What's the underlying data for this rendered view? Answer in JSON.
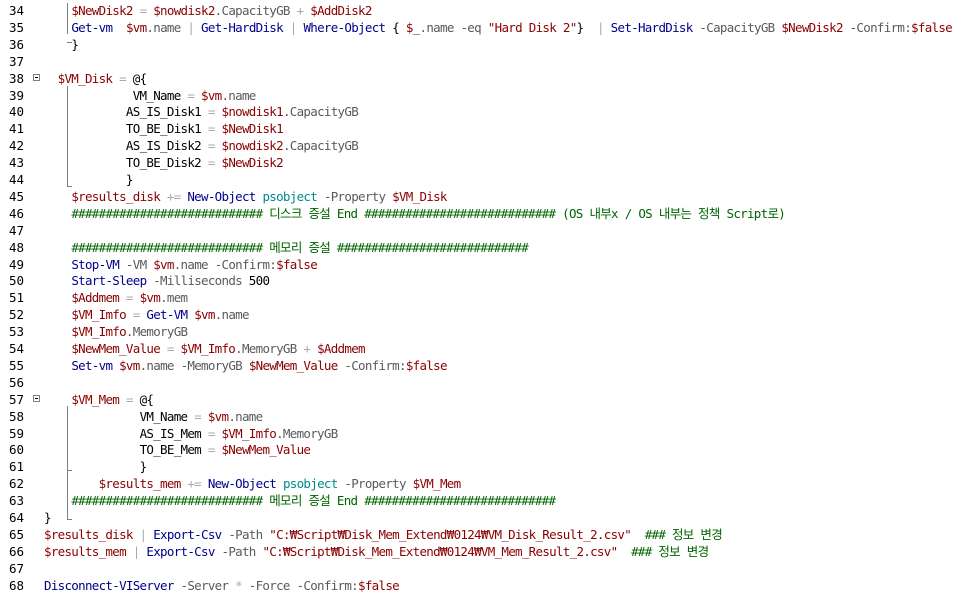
{
  "lines": [
    {
      "n": "34",
      "indent": "    ",
      "tokens": [
        [
          "v",
          "$NewDisk2"
        ],
        [
          "o",
          " = "
        ],
        [
          "v",
          "$nowdisk2"
        ],
        [
          "p",
          ".CapacityGB"
        ],
        [
          "o",
          " + "
        ],
        [
          "v",
          "$AddDisk2"
        ]
      ]
    },
    {
      "n": "35",
      "indent": "    ",
      "tokens": [
        [
          "c",
          "Get-vm"
        ],
        [
          "",
          "  "
        ],
        [
          "v",
          "$vm"
        ],
        [
          "p",
          ".name"
        ],
        [
          "o",
          " | "
        ],
        [
          "c",
          "Get-HardDisk"
        ],
        [
          "o",
          " | "
        ],
        [
          "c",
          "Where-Object"
        ],
        [
          "",
          " { "
        ],
        [
          "v",
          "$_"
        ],
        [
          "p",
          ".name"
        ],
        [
          "",
          " "
        ],
        [
          "p",
          "-eq"
        ],
        [
          "",
          " "
        ],
        [
          "s",
          "\"Hard Disk 2\""
        ],
        [
          "",
          "}  "
        ],
        [
          "o",
          "| "
        ],
        [
          "c",
          "Set-HardDisk"
        ],
        [
          "",
          " "
        ],
        [
          "p",
          "-CapacityGB"
        ],
        [
          "",
          " "
        ],
        [
          "v",
          "$NewDisk2"
        ],
        [
          "",
          " "
        ],
        [
          "p",
          "-Confirm:"
        ],
        [
          "v",
          "$false"
        ]
      ]
    },
    {
      "n": "36",
      "indent": "    ",
      "tokens": [
        [
          "",
          "}"
        ]
      ]
    },
    {
      "n": "37",
      "indent": "",
      "tokens": []
    },
    {
      "n": "38",
      "indent": "  ",
      "tokens": [
        [
          "v",
          "$VM_Disk"
        ],
        [
          "o",
          " = "
        ],
        [
          "",
          "@{"
        ]
      ]
    },
    {
      "n": "39",
      "indent": "             ",
      "tokens": [
        [
          "",
          "VM_Name"
        ],
        [
          "o",
          " = "
        ],
        [
          "v",
          "$vm"
        ],
        [
          "p",
          ".name"
        ]
      ]
    },
    {
      "n": "40",
      "indent": "            ",
      "tokens": [
        [
          "",
          "AS_IS_Disk1"
        ],
        [
          "o",
          " = "
        ],
        [
          "v",
          "$nowdisk1"
        ],
        [
          "p",
          ".CapacityGB"
        ]
      ]
    },
    {
      "n": "41",
      "indent": "            ",
      "tokens": [
        [
          "",
          "TO_BE_Disk1"
        ],
        [
          "o",
          " = "
        ],
        [
          "v",
          "$NewDisk1"
        ]
      ]
    },
    {
      "n": "42",
      "indent": "            ",
      "tokens": [
        [
          "",
          "AS_IS_Disk2"
        ],
        [
          "o",
          " = "
        ],
        [
          "v",
          "$nowdisk2"
        ],
        [
          "p",
          ".CapacityGB"
        ]
      ]
    },
    {
      "n": "43",
      "indent": "            ",
      "tokens": [
        [
          "",
          "TO_BE_Disk2"
        ],
        [
          "o",
          " = "
        ],
        [
          "v",
          "$NewDisk2"
        ]
      ]
    },
    {
      "n": "44",
      "indent": "            ",
      "tokens": [
        [
          "",
          "}"
        ]
      ]
    },
    {
      "n": "45",
      "indent": "    ",
      "tokens": [
        [
          "v",
          "$results_disk"
        ],
        [
          "o",
          " += "
        ],
        [
          "c",
          "New-Object"
        ],
        [
          "",
          " "
        ],
        [
          "t",
          "psobject"
        ],
        [
          "",
          " "
        ],
        [
          "p",
          "-Property"
        ],
        [
          "",
          " "
        ],
        [
          "v",
          "$VM_Disk"
        ]
      ]
    },
    {
      "n": "46",
      "indent": "    ",
      "tokens": [
        [
          "cm",
          "############################ 디스크 증설 End ############################ (OS 내부x / OS 내부는 정책 Script로)"
        ]
      ]
    },
    {
      "n": "47",
      "indent": "",
      "tokens": []
    },
    {
      "n": "48",
      "indent": "    ",
      "tokens": [
        [
          "cm",
          "############################ 메모리 증설 ############################"
        ]
      ]
    },
    {
      "n": "49",
      "indent": "    ",
      "tokens": [
        [
          "c",
          "Stop-VM"
        ],
        [
          "",
          " "
        ],
        [
          "p",
          "-VM"
        ],
        [
          "",
          " "
        ],
        [
          "v",
          "$vm"
        ],
        [
          "p",
          ".name"
        ],
        [
          "",
          " "
        ],
        [
          "p",
          "-Confirm:"
        ],
        [
          "v",
          "$false"
        ]
      ]
    },
    {
      "n": "50",
      "indent": "    ",
      "tokens": [
        [
          "c",
          "Start-Sleep"
        ],
        [
          "",
          " "
        ],
        [
          "p",
          "-Milliseconds"
        ],
        [
          "",
          " "
        ],
        [
          "",
          "500"
        ]
      ]
    },
    {
      "n": "51",
      "indent": "    ",
      "tokens": [
        [
          "v",
          "$Addmem"
        ],
        [
          "o",
          " = "
        ],
        [
          "v",
          "$vm"
        ],
        [
          "p",
          ".mem"
        ]
      ]
    },
    {
      "n": "52",
      "indent": "    ",
      "tokens": [
        [
          "v",
          "$VM_Imfo"
        ],
        [
          "o",
          " = "
        ],
        [
          "c",
          "Get-VM"
        ],
        [
          "",
          " "
        ],
        [
          "v",
          "$vm"
        ],
        [
          "p",
          ".name"
        ]
      ]
    },
    {
      "n": "53",
      "indent": "    ",
      "tokens": [
        [
          "v",
          "$VM_Imfo"
        ],
        [
          "p",
          ".MemoryGB"
        ]
      ]
    },
    {
      "n": "54",
      "indent": "    ",
      "tokens": [
        [
          "v",
          "$NewMem_Value"
        ],
        [
          "o",
          " = "
        ],
        [
          "v",
          "$VM_Imfo"
        ],
        [
          "p",
          ".MemoryGB"
        ],
        [
          "o",
          " + "
        ],
        [
          "v",
          "$Addmem"
        ]
      ]
    },
    {
      "n": "55",
      "indent": "    ",
      "tokens": [
        [
          "c",
          "Set-vm"
        ],
        [
          "",
          " "
        ],
        [
          "v",
          "$vm"
        ],
        [
          "p",
          ".name"
        ],
        [
          "",
          " "
        ],
        [
          "p",
          "-MemoryGB"
        ],
        [
          "",
          " "
        ],
        [
          "v",
          "$NewMem_Value"
        ],
        [
          "",
          " "
        ],
        [
          "p",
          "-Confirm:"
        ],
        [
          "v",
          "$false"
        ]
      ]
    },
    {
      "n": "56",
      "indent": "",
      "tokens": []
    },
    {
      "n": "57",
      "indent": "    ",
      "tokens": [
        [
          "v",
          "$VM_Mem"
        ],
        [
          "o",
          " = "
        ],
        [
          "",
          "@{"
        ]
      ]
    },
    {
      "n": "58",
      "indent": "              ",
      "tokens": [
        [
          "",
          "VM_Name"
        ],
        [
          "o",
          " = "
        ],
        [
          "v",
          "$vm"
        ],
        [
          "p",
          ".name"
        ]
      ]
    },
    {
      "n": "59",
      "indent": "              ",
      "tokens": [
        [
          "",
          "AS_IS_Mem"
        ],
        [
          "o",
          " = "
        ],
        [
          "v",
          "$VM_Imfo"
        ],
        [
          "p",
          ".MemoryGB"
        ]
      ]
    },
    {
      "n": "60",
      "indent": "              ",
      "tokens": [
        [
          "",
          "TO_BE_Mem"
        ],
        [
          "o",
          " = "
        ],
        [
          "v",
          "$NewMem_Value"
        ]
      ]
    },
    {
      "n": "61",
      "indent": "              ",
      "tokens": [
        [
          "",
          "}"
        ]
      ]
    },
    {
      "n": "62",
      "indent": "        ",
      "tokens": [
        [
          "v",
          "$results_mem"
        ],
        [
          "o",
          " += "
        ],
        [
          "c",
          "New-Object"
        ],
        [
          "",
          " "
        ],
        [
          "t",
          "psobject"
        ],
        [
          "",
          " "
        ],
        [
          "p",
          "-Property"
        ],
        [
          "",
          " "
        ],
        [
          "v",
          "$VM_Mem"
        ]
      ]
    },
    {
      "n": "63",
      "indent": "    ",
      "tokens": [
        [
          "cm",
          "############################ 메모리 증설 End ############################"
        ]
      ]
    },
    {
      "n": "64",
      "indent": "",
      "tokens": [
        [
          "",
          "}"
        ]
      ]
    },
    {
      "n": "65",
      "indent": "",
      "tokens": [
        [
          "v",
          "$results_disk"
        ],
        [
          "o",
          " | "
        ],
        [
          "c",
          "Export-Csv"
        ],
        [
          "",
          " "
        ],
        [
          "p",
          "-Path"
        ],
        [
          "",
          " "
        ],
        [
          "s",
          "\"C:₩Script₩Disk_Mem_Extend₩0124₩VM_Disk_Result_2.csv\""
        ],
        [
          "",
          "  "
        ],
        [
          "cm",
          "### 정보 변경"
        ]
      ]
    },
    {
      "n": "66",
      "indent": "",
      "tokens": [
        [
          "v",
          "$results_mem"
        ],
        [
          "o",
          " | "
        ],
        [
          "c",
          "Export-Csv"
        ],
        [
          "",
          " "
        ],
        [
          "p",
          "-Path"
        ],
        [
          "",
          " "
        ],
        [
          "s",
          "\"C:₩Script₩Disk_Mem_Extend₩0124₩VM_Mem_Result_2.csv\""
        ],
        [
          "",
          "  "
        ],
        [
          "cm",
          "### 정보 변경"
        ]
      ]
    },
    {
      "n": "67",
      "indent": "",
      "tokens": []
    },
    {
      "n": "68",
      "indent": "",
      "tokens": [
        [
          "c",
          "Disconnect-VIServer"
        ],
        [
          "",
          " "
        ],
        [
          "p",
          "-Server"
        ],
        [
          "",
          " "
        ],
        [
          "o",
          "*"
        ],
        [
          "",
          " "
        ],
        [
          "p",
          "-Force"
        ],
        [
          "",
          " "
        ],
        [
          "p",
          "-Confirm:"
        ],
        [
          "v",
          "$false"
        ]
      ]
    }
  ]
}
